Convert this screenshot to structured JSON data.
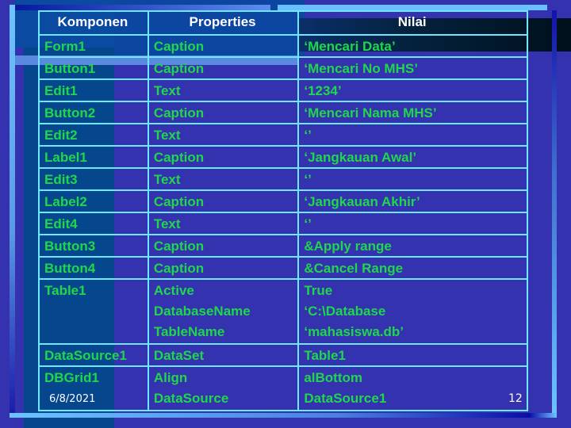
{
  "table": {
    "headers": [
      "Komponen",
      "Properties",
      "Nilai"
    ],
    "rows": [
      {
        "component": "Form1",
        "properties": [
          "Caption"
        ],
        "values": [
          "‘Mencari Data’"
        ]
      },
      {
        "component": "Button1",
        "properties": [
          "Caption"
        ],
        "values": [
          "‘Mencari No MHS’"
        ]
      },
      {
        "component": "Edit1",
        "properties": [
          "Text"
        ],
        "values": [
          "‘1234’"
        ]
      },
      {
        "component": "Button2",
        "properties": [
          "Caption"
        ],
        "values": [
          "‘Mencari Nama MHS’"
        ]
      },
      {
        "component": "Edit2",
        "properties": [
          "Text"
        ],
        "values": [
          "‘’"
        ]
      },
      {
        "component": "Label1",
        "properties": [
          "Caption"
        ],
        "values": [
          "‘Jangkauan Awal’"
        ]
      },
      {
        "component": "Edit3",
        "properties": [
          "Text"
        ],
        "values": [
          "‘’"
        ]
      },
      {
        "component": "Label2",
        "properties": [
          "Caption"
        ],
        "values": [
          "‘Jangkauan Akhir’"
        ]
      },
      {
        "component": "Edit4",
        "properties": [
          "Text"
        ],
        "values": [
          "‘’"
        ]
      },
      {
        "component": "Button3",
        "properties": [
          "Caption"
        ],
        "values": [
          "&Apply range"
        ]
      },
      {
        "component": "Button4",
        "properties": [
          "Caption"
        ],
        "values": [
          "&Cancel Range"
        ]
      },
      {
        "component": "Table1",
        "properties": [
          "Active",
          "DatabaseName",
          "TableName"
        ],
        "values": [
          "True",
          "‘C:\\Database",
          "‘mahasiswa.db’"
        ]
      },
      {
        "component": "DataSource1",
        "properties": [
          "DataSet"
        ],
        "values": [
          "Table1"
        ]
      },
      {
        "component": "DBGrid1",
        "properties": [
          "Align",
          "DataSource"
        ],
        "values": [
          "alBottom",
          "DataSource1"
        ]
      }
    ]
  },
  "footer": {
    "date": "6/8/2021",
    "slide_number": "12"
  },
  "colors": {
    "background": "#3532b0",
    "grid_lines": "#6ee8ff",
    "cell_text": "#1ed84a",
    "header_text": "#ffffff"
  }
}
